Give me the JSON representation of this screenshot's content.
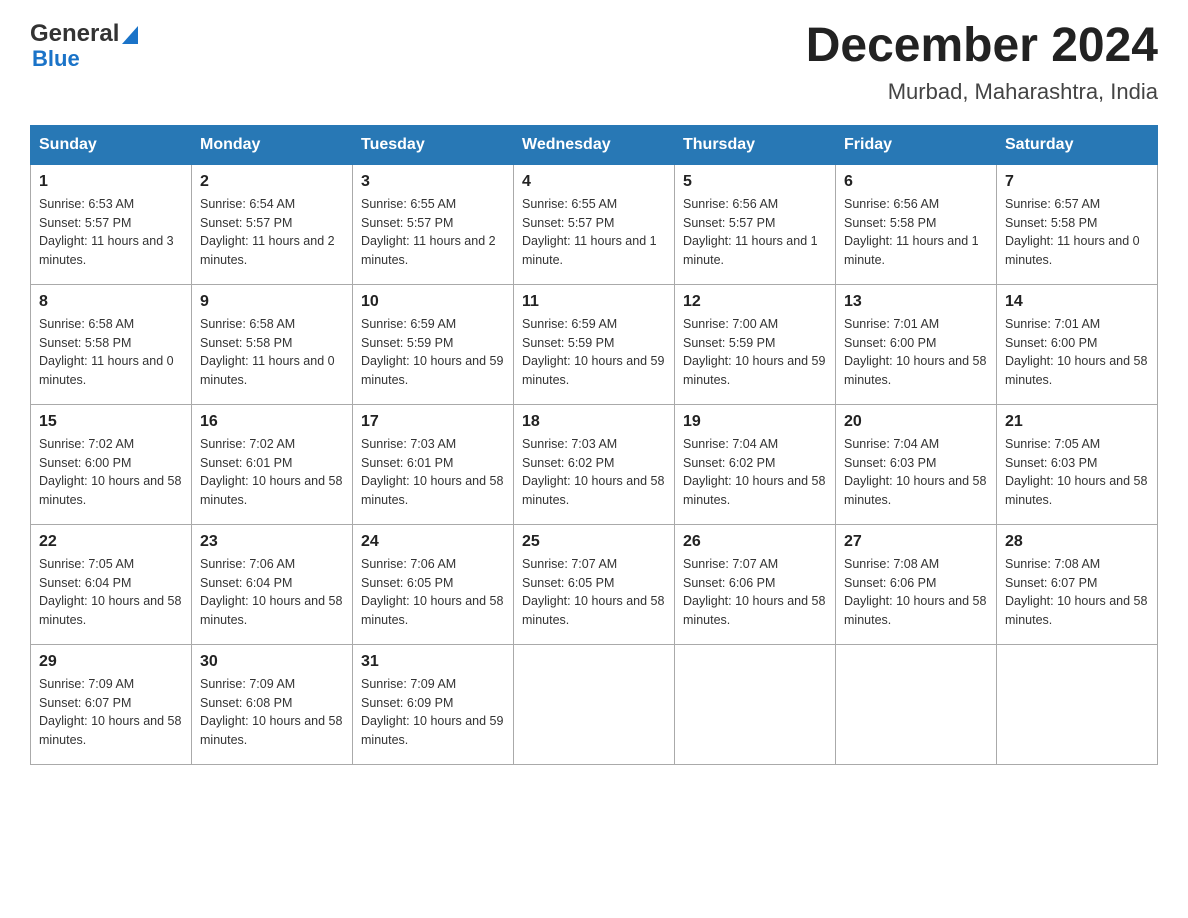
{
  "logo": {
    "general": "General",
    "blue": "Blue"
  },
  "title": "December 2024",
  "subtitle": "Murbad, Maharashtra, India",
  "days_of_week": [
    "Sunday",
    "Monday",
    "Tuesday",
    "Wednesday",
    "Thursday",
    "Friday",
    "Saturday"
  ],
  "weeks": [
    [
      {
        "day": "1",
        "sunrise": "6:53 AM",
        "sunset": "5:57 PM",
        "daylight": "11 hours and 3 minutes."
      },
      {
        "day": "2",
        "sunrise": "6:54 AM",
        "sunset": "5:57 PM",
        "daylight": "11 hours and 2 minutes."
      },
      {
        "day": "3",
        "sunrise": "6:55 AM",
        "sunset": "5:57 PM",
        "daylight": "11 hours and 2 minutes."
      },
      {
        "day": "4",
        "sunrise": "6:55 AM",
        "sunset": "5:57 PM",
        "daylight": "11 hours and 1 minute."
      },
      {
        "day": "5",
        "sunrise": "6:56 AM",
        "sunset": "5:57 PM",
        "daylight": "11 hours and 1 minute."
      },
      {
        "day": "6",
        "sunrise": "6:56 AM",
        "sunset": "5:58 PM",
        "daylight": "11 hours and 1 minute."
      },
      {
        "day": "7",
        "sunrise": "6:57 AM",
        "sunset": "5:58 PM",
        "daylight": "11 hours and 0 minutes."
      }
    ],
    [
      {
        "day": "8",
        "sunrise": "6:58 AM",
        "sunset": "5:58 PM",
        "daylight": "11 hours and 0 minutes."
      },
      {
        "day": "9",
        "sunrise": "6:58 AM",
        "sunset": "5:58 PM",
        "daylight": "11 hours and 0 minutes."
      },
      {
        "day": "10",
        "sunrise": "6:59 AM",
        "sunset": "5:59 PM",
        "daylight": "10 hours and 59 minutes."
      },
      {
        "day": "11",
        "sunrise": "6:59 AM",
        "sunset": "5:59 PM",
        "daylight": "10 hours and 59 minutes."
      },
      {
        "day": "12",
        "sunrise": "7:00 AM",
        "sunset": "5:59 PM",
        "daylight": "10 hours and 59 minutes."
      },
      {
        "day": "13",
        "sunrise": "7:01 AM",
        "sunset": "6:00 PM",
        "daylight": "10 hours and 58 minutes."
      },
      {
        "day": "14",
        "sunrise": "7:01 AM",
        "sunset": "6:00 PM",
        "daylight": "10 hours and 58 minutes."
      }
    ],
    [
      {
        "day": "15",
        "sunrise": "7:02 AM",
        "sunset": "6:00 PM",
        "daylight": "10 hours and 58 minutes."
      },
      {
        "day": "16",
        "sunrise": "7:02 AM",
        "sunset": "6:01 PM",
        "daylight": "10 hours and 58 minutes."
      },
      {
        "day": "17",
        "sunrise": "7:03 AM",
        "sunset": "6:01 PM",
        "daylight": "10 hours and 58 minutes."
      },
      {
        "day": "18",
        "sunrise": "7:03 AM",
        "sunset": "6:02 PM",
        "daylight": "10 hours and 58 minutes."
      },
      {
        "day": "19",
        "sunrise": "7:04 AM",
        "sunset": "6:02 PM",
        "daylight": "10 hours and 58 minutes."
      },
      {
        "day": "20",
        "sunrise": "7:04 AM",
        "sunset": "6:03 PM",
        "daylight": "10 hours and 58 minutes."
      },
      {
        "day": "21",
        "sunrise": "7:05 AM",
        "sunset": "6:03 PM",
        "daylight": "10 hours and 58 minutes."
      }
    ],
    [
      {
        "day": "22",
        "sunrise": "7:05 AM",
        "sunset": "6:04 PM",
        "daylight": "10 hours and 58 minutes."
      },
      {
        "day": "23",
        "sunrise": "7:06 AM",
        "sunset": "6:04 PM",
        "daylight": "10 hours and 58 minutes."
      },
      {
        "day": "24",
        "sunrise": "7:06 AM",
        "sunset": "6:05 PM",
        "daylight": "10 hours and 58 minutes."
      },
      {
        "day": "25",
        "sunrise": "7:07 AM",
        "sunset": "6:05 PM",
        "daylight": "10 hours and 58 minutes."
      },
      {
        "day": "26",
        "sunrise": "7:07 AM",
        "sunset": "6:06 PM",
        "daylight": "10 hours and 58 minutes."
      },
      {
        "day": "27",
        "sunrise": "7:08 AM",
        "sunset": "6:06 PM",
        "daylight": "10 hours and 58 minutes."
      },
      {
        "day": "28",
        "sunrise": "7:08 AM",
        "sunset": "6:07 PM",
        "daylight": "10 hours and 58 minutes."
      }
    ],
    [
      {
        "day": "29",
        "sunrise": "7:09 AM",
        "sunset": "6:07 PM",
        "daylight": "10 hours and 58 minutes."
      },
      {
        "day": "30",
        "sunrise": "7:09 AM",
        "sunset": "6:08 PM",
        "daylight": "10 hours and 58 minutes."
      },
      {
        "day": "31",
        "sunrise": "7:09 AM",
        "sunset": "6:09 PM",
        "daylight": "10 hours and 59 minutes."
      },
      null,
      null,
      null,
      null
    ]
  ],
  "labels": {
    "sunrise": "Sunrise:",
    "sunset": "Sunset:",
    "daylight": "Daylight:"
  }
}
